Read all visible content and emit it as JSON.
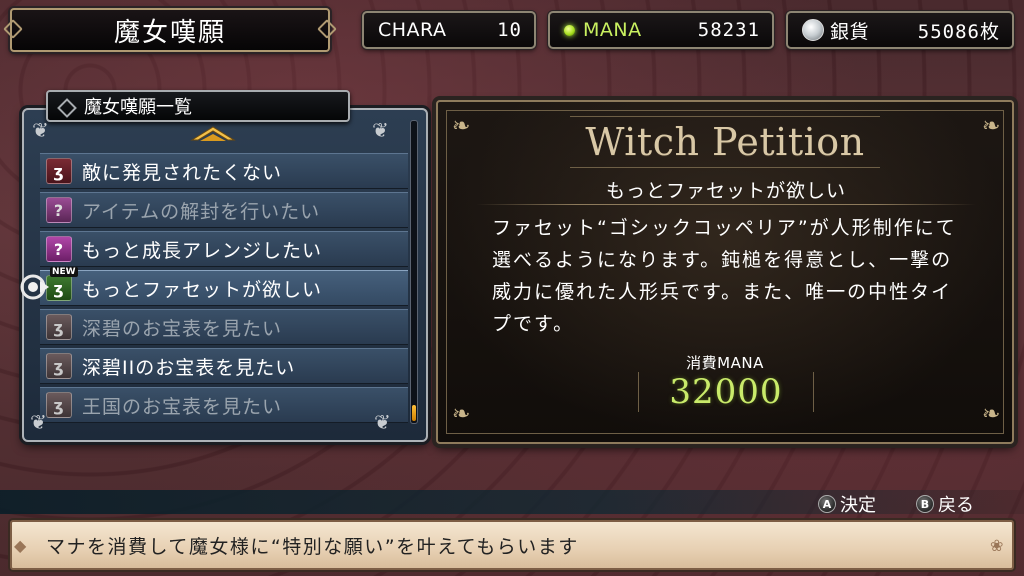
{
  "header": {
    "title": "魔女嘆願",
    "chara": {
      "label": "CHARA",
      "value": "10"
    },
    "mana": {
      "label": "MANA",
      "value": "58231",
      "icon": "mana-orb-icon",
      "color": "#c9f060"
    },
    "coins": {
      "label": "銀貨",
      "value": "55086枚",
      "icon": "silver-coin-icon"
    }
  },
  "list": {
    "title": "魔女嘆願一覧",
    "scroll_position": 1.0,
    "items": [
      {
        "label": "敵に発見されたくない",
        "icon": "petition-icon",
        "state": "available"
      },
      {
        "label": "アイテムの解封を行いたい",
        "icon": "question-icon",
        "state": "locked"
      },
      {
        "label": "もっと成長アレンジしたい",
        "icon": "question-icon",
        "state": "available"
      },
      {
        "label": "もっとファセットが欲しい",
        "icon": "petition-icon",
        "state": "selected",
        "badge": "NEW"
      },
      {
        "label": "深碧のお宝表を見たい",
        "icon": "petition-icon",
        "state": "dim"
      },
      {
        "label": "深碧IIのお宝表を見たい",
        "icon": "petition-icon",
        "state": "available"
      },
      {
        "label": "王国のお宝表を見たい",
        "icon": "petition-icon",
        "state": "dim"
      }
    ]
  },
  "detail": {
    "heading": "Witch Petition",
    "wish_name": "もっとファセットが欲しい",
    "description": "ファセット“ゴシックコッペリア”が人形制作にて選べるようになります。鈍槌を得意とし、一撃の威力に優れた人形兵です。また、唯一の中性タイプです。",
    "cost_label": "消費MANA",
    "cost_value": "32000",
    "cost_color": "#c9ea6a"
  },
  "controls": {
    "confirm": {
      "button": "A",
      "label": "決定"
    },
    "back": {
      "button": "B",
      "label": "戻る"
    }
  },
  "message": "マナを消費して魔女様に“特別な願い”を叶えてもらいます"
}
